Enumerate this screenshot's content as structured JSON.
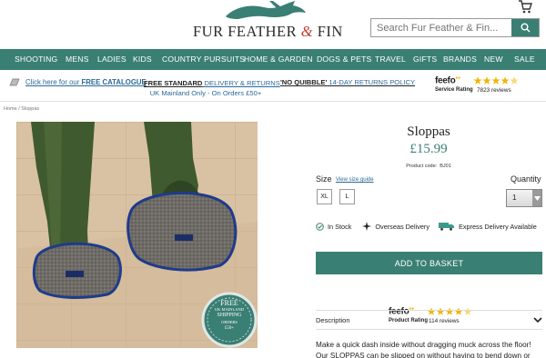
{
  "header": {
    "logo_text_left": "FUR FEATHER",
    "logo_amp": "&",
    "logo_text_right": "FIN",
    "search_placeholder": "Search Fur Feather & Fin..."
  },
  "nav": [
    "SHOOTING",
    "MENS",
    "LADIES",
    "KIDS",
    "COUNTRY PURSUITS",
    "HOME & GARDEN",
    "DOGS & PETS",
    "TRAVEL",
    "GIFTS",
    "BRANDS",
    "NEW",
    "SALE"
  ],
  "strip": {
    "catalogue_prefix": "Click here for our ",
    "catalogue_bold": "FREE CATALOGUE",
    "delivery_bold": "FREE STANDARD",
    "delivery_rest": " DELIVERY & RETURNS",
    "delivery_line2": "UK Mainland Only - On Orders £50+",
    "returns_bold": "'NO QUIBBLE'",
    "returns_rest": " 14-DAY RETURNS POLICY"
  },
  "feefo_top": {
    "logo": "feefo",
    "label": "Service Rating",
    "count": "7823 reviews",
    "rating": 4.5
  },
  "breadcrumb": {
    "home": "Home",
    "sep": " / ",
    "current": "Sloppas"
  },
  "product": {
    "title": "Sloppas",
    "price": "£15.99",
    "code_label": "Product code:",
    "code": "BJ01",
    "size_label": "Size",
    "size_guide": "View size guide",
    "sizes": [
      "XL",
      "L"
    ],
    "quantity_label": "Quantity",
    "quantity": "1",
    "in_stock": "In Stock",
    "overseas": "Overseas Delivery",
    "express": "Express Delivery Available",
    "basket": "ADD TO BASKET",
    "description_label": "Description",
    "description": "Make a quick dash inside without dragging muck across the floor! Our SLOPPAS can be slipped on without having to bend down or remove"
  },
  "badge": {
    "line1": "FREE",
    "line2": "UK MAINLAND",
    "line3": "SHIPPING",
    "line4": "ORDERS",
    "line5": "£50+"
  },
  "feefo_mid": {
    "logo": "feefo",
    "label": "Product Rating",
    "count": "114 reviews",
    "rating": 4.5
  },
  "colors": {
    "brand": "#3a7f74",
    "link": "#2a6a98"
  }
}
